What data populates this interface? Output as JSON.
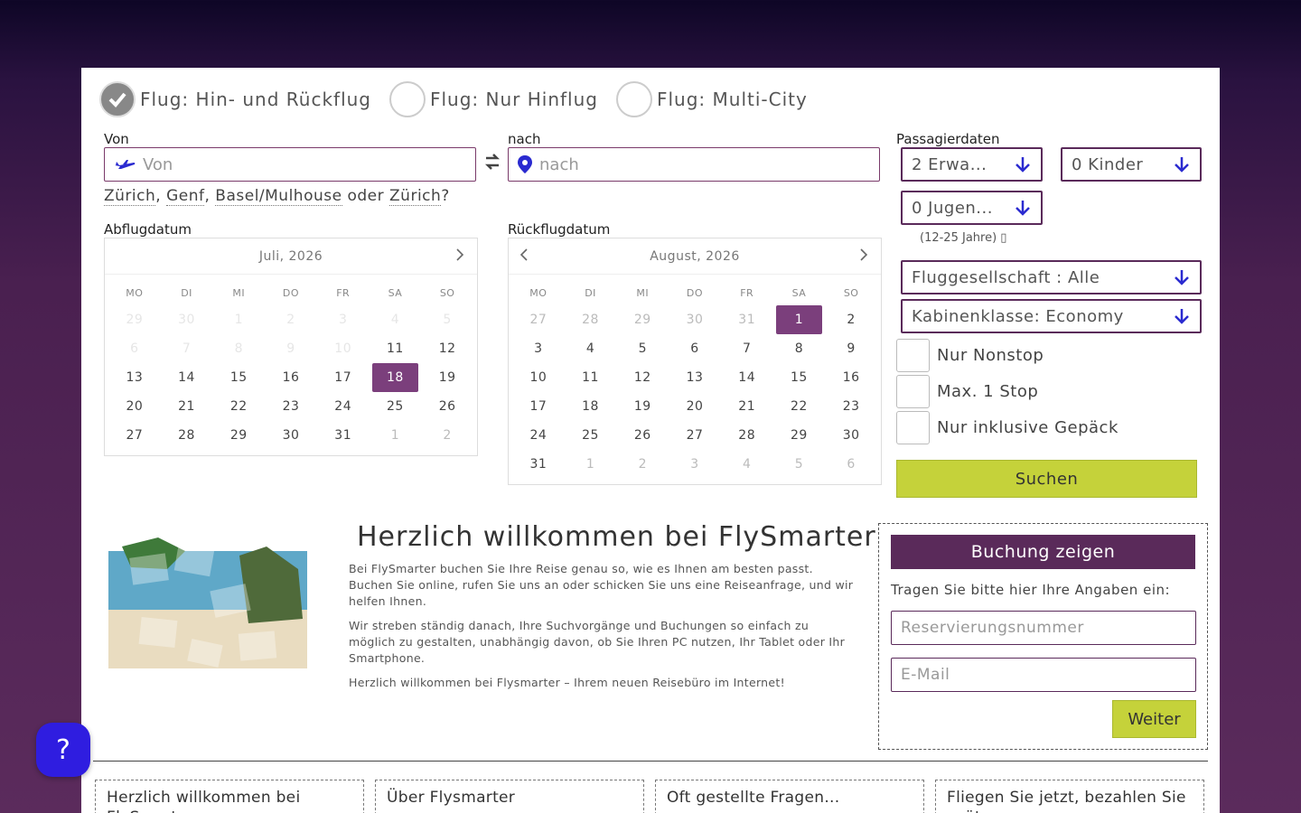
{
  "trip_types": [
    {
      "label": "Flug: Hin- und Rückflug",
      "checked": true
    },
    {
      "label": "Flug: Nur Hinflug",
      "checked": false
    },
    {
      "label": "Flug: Multi-City",
      "checked": false
    }
  ],
  "from": {
    "label": "Von",
    "placeholder": "Von"
  },
  "to": {
    "label": "nach",
    "placeholder": "nach"
  },
  "suggestions": {
    "items": [
      "Zürich",
      "Genf",
      "Basel/Mulhouse"
    ],
    "sep1": ", ",
    "sep2": ", ",
    "or_text": " oder ",
    "alt": "Zürich",
    "end": "?"
  },
  "departure": {
    "label": "Abflugdatum",
    "month": "Juli, 2026",
    "weekdays": [
      "MO",
      "DI",
      "MI",
      "DO",
      "FR",
      "SA",
      "SO"
    ],
    "weeks": [
      [
        "29",
        "30",
        "1",
        "2",
        "3",
        "4",
        "5"
      ],
      [
        "6",
        "7",
        "8",
        "9",
        "10",
        "11",
        "12"
      ],
      [
        "13",
        "14",
        "15",
        "16",
        "17",
        "18",
        "19"
      ],
      [
        "20",
        "21",
        "22",
        "23",
        "24",
        "25",
        "26"
      ],
      [
        "27",
        "28",
        "29",
        "30",
        "31",
        "1",
        "2"
      ]
    ],
    "selected": "18"
  },
  "return": {
    "label": "Rückflugdatum",
    "month": "August, 2026",
    "weekdays": [
      "MO",
      "DI",
      "MI",
      "DO",
      "FR",
      "SA",
      "SO"
    ],
    "weeks": [
      [
        "27",
        "28",
        "29",
        "30",
        "31",
        "1",
        "2"
      ],
      [
        "3",
        "4",
        "5",
        "6",
        "7",
        "8",
        "9"
      ],
      [
        "10",
        "11",
        "12",
        "13",
        "14",
        "15",
        "16"
      ],
      [
        "17",
        "18",
        "19",
        "20",
        "21",
        "22",
        "23"
      ],
      [
        "24",
        "25",
        "26",
        "27",
        "28",
        "29",
        "30"
      ],
      [
        "31",
        "1",
        "2",
        "3",
        "4",
        "5",
        "6"
      ]
    ],
    "selected": "1"
  },
  "passengers": {
    "label": "Passagierdaten",
    "adults": "2 Erwa...",
    "children": "0 Kinder",
    "youth": "0 Jugen...",
    "youth_hint": "(12-25 Jahre) ▯"
  },
  "airline": "Fluggesellschaft : Alle",
  "cabin": "Kabinenklasse: Economy",
  "filters": [
    "Nur Nonstop",
    "Max. 1 Stop",
    "Nur inklusive Gepäck"
  ],
  "search_button": "Suchen",
  "welcome": {
    "title": "Herzlich willkommen bei FlySmarter",
    "p1": "Bei FlySmarter buchen Sie Ihre Reise genau so, wie es Ihnen am besten passt. Buchen Sie online, rufen Sie uns an oder schicken Sie uns eine Reiseanfrage, und wir helfen Ihnen.",
    "p2": "Wir streben ständig danach, Ihre Suchvorgänge und Buchungen so einfach zu möglich zu gestalten, unabhängig davon, ob Sie Ihren PC nutzen, Ihr Tablet oder Ihr Smartphone.",
    "p3": "Herzlich willkommen bei Flysmarter – Ihrem neuen Reisebüro im Internet!"
  },
  "booking": {
    "title": "Buchung zeigen",
    "subtitle": "Tragen Sie bitte hier Ihre Angaben ein:",
    "reservation_placeholder": "Reservierungsnummer",
    "email_placeholder": "E-Mail",
    "button": "Weiter"
  },
  "info_cards": [
    "Herzlich willkommen bei FlySmarter",
    "Über Flysmarter",
    "Oft gestellte Fragen...",
    "Fliegen Sie jetzt, bezahlen Sie später"
  ],
  "help_button": "?",
  "colors": {
    "accent": "#7b3f7c",
    "primary_dark": "#5a2a5a",
    "button": "#c5d23a",
    "help": "#2f1de0",
    "arrow": "#2b2bd0"
  }
}
